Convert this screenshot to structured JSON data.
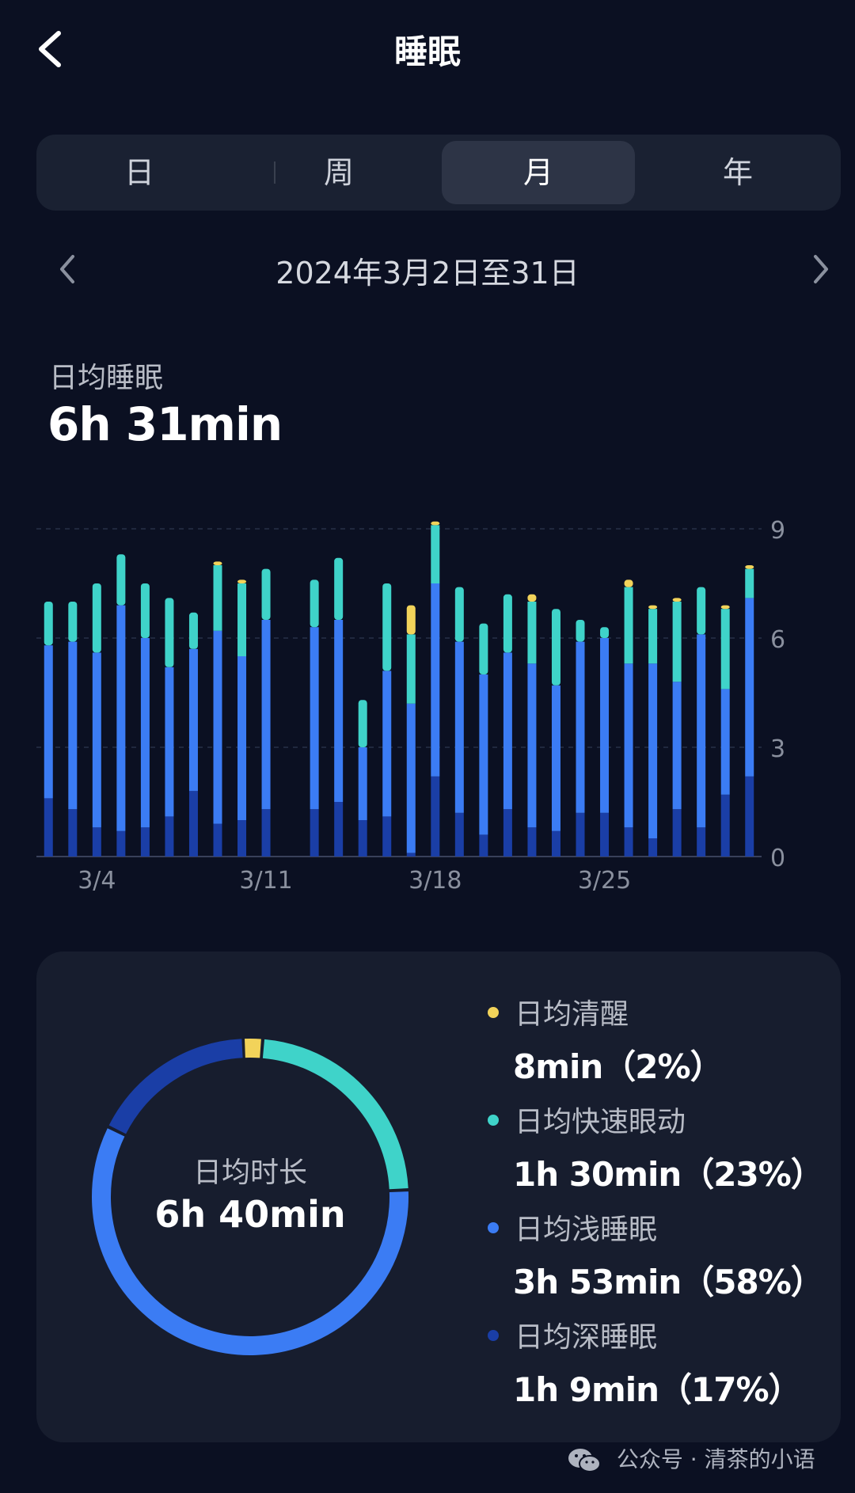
{
  "header": {
    "title": "睡眠"
  },
  "tabs": [
    {
      "label": "日",
      "active": false
    },
    {
      "label": "周",
      "active": false
    },
    {
      "label": "月",
      "active": true
    },
    {
      "label": "年",
      "active": false
    }
  ],
  "range": {
    "text": "2024年3月2日至31日"
  },
  "summary": {
    "label": "日均睡眠",
    "value": "6h 31min"
  },
  "chart_data": {
    "type": "bar",
    "stacked": true,
    "x_tick_labels": [
      "3/4",
      "3/11",
      "3/18",
      "3/25"
    ],
    "y_ticks": [
      0,
      3,
      6,
      9
    ],
    "ylim": [
      0,
      9
    ],
    "y_axis_position": "right",
    "grid": true,
    "series_order": [
      "deep",
      "light",
      "rem",
      "awake"
    ],
    "colors": {
      "deep": "#1a3ea6",
      "light": "#3b7cf4",
      "rem": "#3fd3c9",
      "awake": "#f2d35a"
    },
    "days": [
      {
        "date": "3/2",
        "deep": 1.6,
        "light": 4.2,
        "rem": 1.2,
        "awake": 0.0
      },
      {
        "date": "3/3",
        "deep": 1.3,
        "light": 4.6,
        "rem": 1.1,
        "awake": 0.0
      },
      {
        "date": "3/4",
        "deep": 0.8,
        "light": 4.8,
        "rem": 1.9,
        "awake": 0.0
      },
      {
        "date": "3/5",
        "deep": 0.7,
        "light": 6.2,
        "rem": 1.4,
        "awake": 0.0
      },
      {
        "date": "3/6",
        "deep": 0.8,
        "light": 5.2,
        "rem": 1.5,
        "awake": 0.0
      },
      {
        "date": "3/7",
        "deep": 1.1,
        "light": 4.1,
        "rem": 1.9,
        "awake": 0.0
      },
      {
        "date": "3/8",
        "deep": 1.8,
        "light": 3.9,
        "rem": 1.0,
        "awake": 0.0
      },
      {
        "date": "3/9",
        "deep": 0.9,
        "light": 5.3,
        "rem": 1.8,
        "awake": 0.1
      },
      {
        "date": "3/10",
        "deep": 1.0,
        "light": 4.5,
        "rem": 2.0,
        "awake": 0.1
      },
      {
        "date": "3/11",
        "deep": 1.3,
        "light": 5.2,
        "rem": 1.4,
        "awake": 0.0
      },
      {
        "date": "3/12",
        "deep": null,
        "light": null,
        "rem": null,
        "awake": null
      },
      {
        "date": "3/13",
        "deep": 1.3,
        "light": 5.0,
        "rem": 1.3,
        "awake": 0.0
      },
      {
        "date": "3/14",
        "deep": 1.5,
        "light": 5.0,
        "rem": 1.7,
        "awake": 0.0
      },
      {
        "date": "3/15",
        "deep": 1.0,
        "light": 2.0,
        "rem": 1.3,
        "awake": 0.0
      },
      {
        "date": "3/16",
        "deep": 1.1,
        "light": 4.0,
        "rem": 2.4,
        "awake": 0.0
      },
      {
        "date": "3/17",
        "deep": 0.1,
        "light": 4.1,
        "rem": 1.9,
        "awake": 0.8
      },
      {
        "date": "3/18",
        "deep": 2.2,
        "light": 5.3,
        "rem": 1.6,
        "awake": 0.1
      },
      {
        "date": "3/19",
        "deep": 1.2,
        "light": 4.7,
        "rem": 1.5,
        "awake": 0.0
      },
      {
        "date": "3/20",
        "deep": 0.6,
        "light": 4.4,
        "rem": 1.4,
        "awake": 0.0
      },
      {
        "date": "3/21",
        "deep": 1.3,
        "light": 4.3,
        "rem": 1.6,
        "awake": 0.0
      },
      {
        "date": "3/22",
        "deep": 0.8,
        "light": 4.5,
        "rem": 1.7,
        "awake": 0.2
      },
      {
        "date": "3/23",
        "deep": 0.7,
        "light": 4.0,
        "rem": 2.1,
        "awake": 0.0
      },
      {
        "date": "3/24",
        "deep": 1.2,
        "light": 4.7,
        "rem": 0.6,
        "awake": 0.0
      },
      {
        "date": "3/25",
        "deep": 1.2,
        "light": 4.8,
        "rem": 0.3,
        "awake": 0.0
      },
      {
        "date": "3/26",
        "deep": 0.8,
        "light": 4.5,
        "rem": 2.1,
        "awake": 0.2
      },
      {
        "date": "3/27",
        "deep": 0.5,
        "light": 4.8,
        "rem": 1.5,
        "awake": 0.1
      },
      {
        "date": "3/28",
        "deep": 1.3,
        "light": 3.5,
        "rem": 2.2,
        "awake": 0.1
      },
      {
        "date": "3/29",
        "deep": 0.8,
        "light": 5.3,
        "rem": 1.3,
        "awake": 0.0
      },
      {
        "date": "3/30",
        "deep": 1.7,
        "light": 2.9,
        "rem": 2.2,
        "awake": 0.1
      },
      {
        "date": "3/31",
        "deep": 2.2,
        "light": 4.9,
        "rem": 0.8,
        "awake": 0.1
      }
    ]
  },
  "card": {
    "donut_label": "日均时长",
    "donut_value": "6h 40min",
    "donut": [
      {
        "key": "awake",
        "percent": 2,
        "color": "#f2d35a"
      },
      {
        "key": "rem",
        "percent": 23,
        "color": "#3fd3c9"
      },
      {
        "key": "light",
        "percent": 58,
        "color": "#3b7cf4"
      },
      {
        "key": "deep",
        "percent": 17,
        "color": "#1a3ea6"
      }
    ],
    "legend": [
      {
        "name": "日均清醒",
        "value": "8min（2%）",
        "color": "#f2d35a"
      },
      {
        "name": "日均快速眼动",
        "value": "1h 30min（23%）",
        "color": "#3fd3c9"
      },
      {
        "name": "日均浅睡眠",
        "value": "3h 53min（58%）",
        "color": "#3b7cf4"
      },
      {
        "name": "日均深睡眠",
        "value": "1h 9min（17%）",
        "color": "#1a3ea6"
      }
    ]
  },
  "watermark": {
    "text": "公众号 · 清茶的小语"
  }
}
